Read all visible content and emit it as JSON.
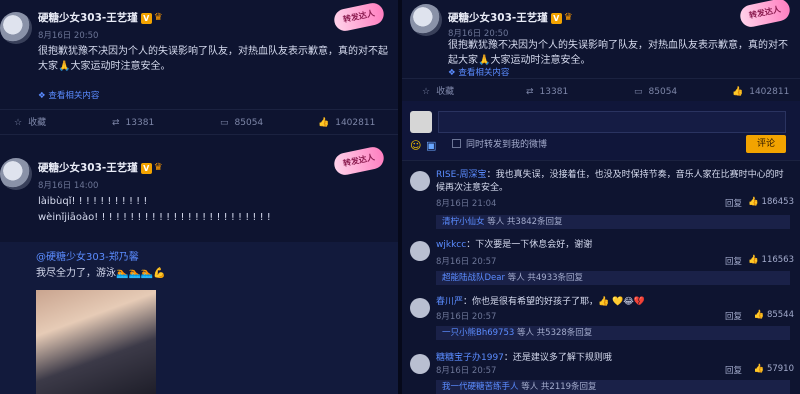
{
  "colors": {
    "accent": "#f2a300",
    "link": "#5b8cff",
    "bg": "#0e1430"
  },
  "left": {
    "post1": {
      "username": "硬糖少女303-王艺瑾",
      "timestamp": "8月16日 20:50",
      "text": "很抱歉犹豫不决因为个人的失误影响了队友，对热血队友表示歉意，真的对不起大家🙏大家运动时注意安全。",
      "link": "❖ 查看相关内容",
      "actions": {
        "collect": "收藏",
        "repost": "13381",
        "comment": "85054",
        "like": "1402811"
      },
      "sticker": "转发达人"
    },
    "post2": {
      "username": "硬糖少女303-王艺瑾",
      "timestamp": "8月16日 14:00",
      "line1": "làibùqǐ! ! ! ! ! ! ! ! ! ! !",
      "line2": "wèinǐjiāoào! ! ! ! ! ! ! ! ! ! ! ! ! ! ! ! ! ! ! ! ! ! ! ! !",
      "sticker": "转发达人"
    },
    "repost": {
      "username": "@硬糖少女303-郑乃馨",
      "text": "我尽全力了，游泳🏊🏊🏊💪"
    }
  },
  "right": {
    "post": {
      "username": "硬糖少女303-王艺瑾",
      "timestamp": "8月16日 20:50",
      "text": "很抱歉犹豫不决因为个人的失误影响了队友，对热血队友表示歉意，真的对不起大家🙏大家运动时注意安全。",
      "link": "❖ 查看相关内容",
      "sticker": "转发达人"
    },
    "actions": {
      "collect": "收藏",
      "repost": "13381",
      "comment": "85054",
      "like": "1402811"
    },
    "compose": {
      "placeholder": "",
      "repost_label": "同时转发到我的微博",
      "submit": "评论"
    },
    "comments": [
      {
        "name": "RISE-周深宝",
        "text": "：我也真失误，没接着住，也没及时保持节奏，音乐人家在比赛时中心的时候再次注意安全。",
        "time": "8月16日 21:04",
        "reply": "回复",
        "likes": "186453",
        "sub_name": "清柠小仙女",
        "sub_text": "等人 共3842条回复"
      },
      {
        "name": "wjkkcc",
        "text": "：下次要是一下休息会好，谢谢",
        "time": "8月16日 20:57",
        "reply": "回复",
        "likes": "116563",
        "sub_name": "超能陆战队Dear",
        "sub_text": "等人 共4933条回复"
      },
      {
        "name": "春川严",
        "text": "：你也是很有希望的好孩子了耶，👍 💛😂💔",
        "time": "8月16日 20:57",
        "reply": "回复",
        "likes": "85544",
        "sub_name": "一只小熊Bh69753",
        "sub_text": "等人 共5328条回复"
      },
      {
        "name": "糖糖宝子办1997",
        "text": "：还是建议多了解下规则哦",
        "time": "8月16日 20:57",
        "reply": "回复",
        "likes": "57910",
        "sub_name": "我一代硬糖苦练手人",
        "sub_text": "等人 共2119条回复"
      }
    ]
  }
}
